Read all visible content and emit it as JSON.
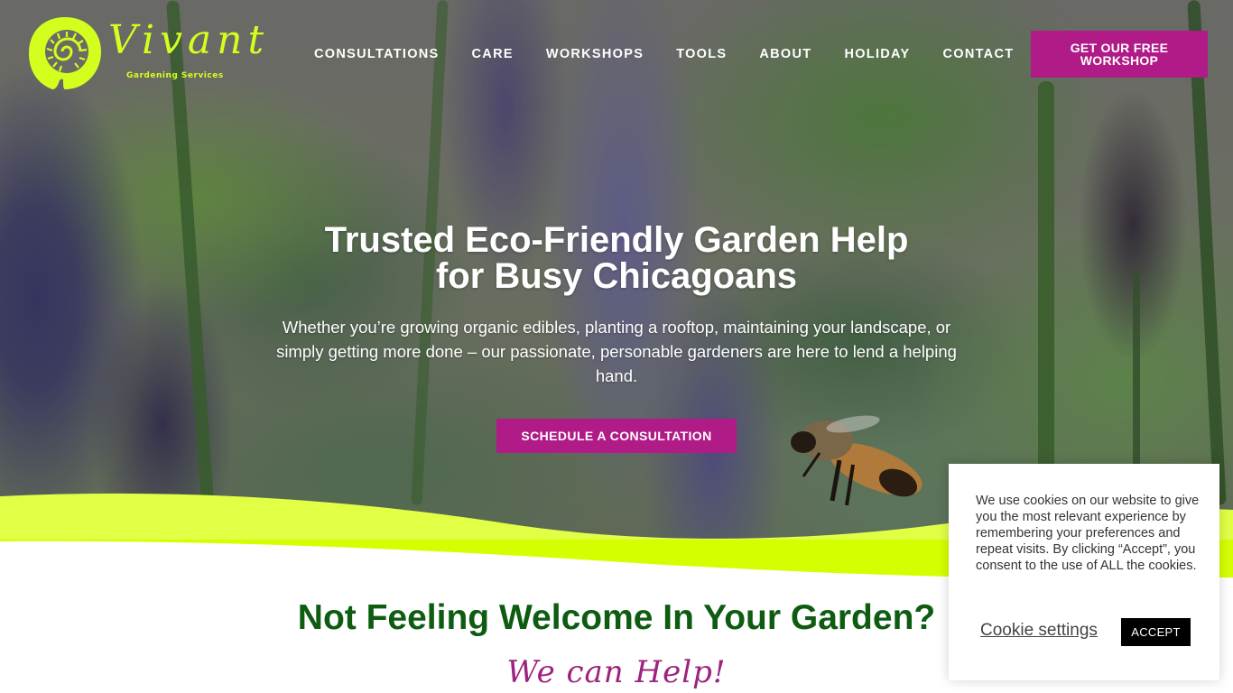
{
  "brand": {
    "name": "Vivant",
    "tagline": "Gardening Services",
    "logo_icon": "fern-spiral-icon",
    "colors": {
      "lime": "#d4ff00",
      "magenta": "#b01b87",
      "dark_green": "#0e5b12",
      "script_purple": "#9c237e"
    }
  },
  "nav": {
    "items": [
      {
        "label": "CONSULTATIONS"
      },
      {
        "label": "CARE"
      },
      {
        "label": "WORKSHOPS"
      },
      {
        "label": "TOOLS"
      },
      {
        "label": "ABOUT"
      },
      {
        "label": "HOLIDAY"
      },
      {
        "label": "CONTACT"
      }
    ],
    "cta_label": "GET OUR FREE WORKSHOP"
  },
  "hero": {
    "title_line1": "Trusted Eco-Friendly Garden Help",
    "title_line2": "for Busy Chicagoans",
    "subtitle": "Whether you’re growing organic edibles, planting a rooftop, maintaining your landscape, or simply getting more done – our passionate, personable gardeners are here to lend a helping hand.",
    "cta_label": "SCHEDULE A CONSULTATION",
    "image_subject": "bee-on-lavender-hyssop"
  },
  "section": {
    "title": "Not Feeling Welcome In Your Garden?",
    "script_subtitle": "We can Help!"
  },
  "cookie_banner": {
    "message": "We use cookies on our website to give you the most relevant experience by remembering your preferences and repeat visits. By clicking “Accept”, you consent to the use of ALL the cookies.",
    "settings_label": "Cookie settings",
    "accept_label": "ACCEPT"
  }
}
